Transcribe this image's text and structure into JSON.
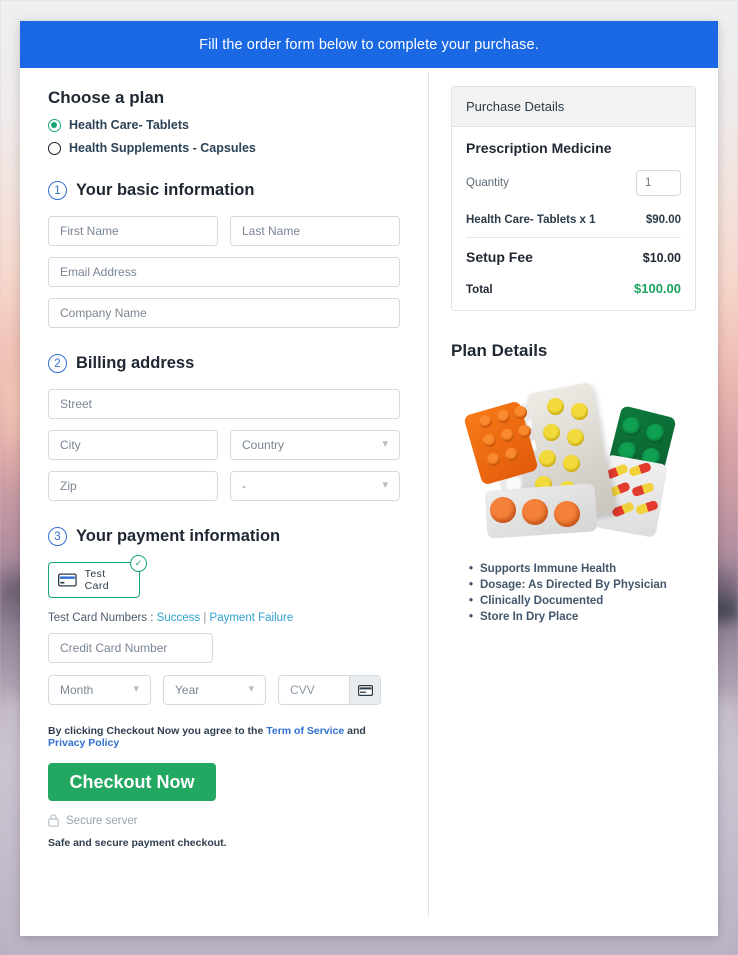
{
  "banner": {
    "text": "Fill the order form below to complete your purchase."
  },
  "plan": {
    "title": "Choose a plan",
    "options": [
      {
        "label": "Health Care- Tablets",
        "selected": true
      },
      {
        "label": "Health Supplements - Capsules",
        "selected": false
      }
    ]
  },
  "steps": [
    {
      "number": "1",
      "label": "Your basic information"
    },
    {
      "number": "2",
      "label": "Billing address"
    },
    {
      "number": "3",
      "label": "Your payment information"
    }
  ],
  "basic_info": {
    "first_name_placeholder": "First Name",
    "last_name_placeholder": "Last Name",
    "email_placeholder": "Email Address",
    "company_placeholder": "Company Name"
  },
  "billing": {
    "street_placeholder": "Street",
    "city_placeholder": "City",
    "country_value": "Country",
    "zip_placeholder": "Zip",
    "state_value": "-"
  },
  "payment": {
    "method_label": "Test Card",
    "method_selected": true,
    "check_glyph": "✓",
    "test_cards_prefix": "Test Card Numbers :",
    "test_card_success": "Success",
    "test_card_separator": "|",
    "test_card_failure": "Payment Failure",
    "card_number_placeholder": "Credit Card Number",
    "month_value": "Month",
    "year_value": "Year",
    "cvv_placeholder": "CVV"
  },
  "terms": {
    "prefix": "By clicking Checkout Now you agree to the ",
    "tos_link": "Term of Service",
    "middle": " and ",
    "privacy_link": "Privacy Policy"
  },
  "checkout": {
    "button_label": "Checkout Now",
    "secure_text": "Secure server",
    "safe_note": "Safe and secure payment checkout."
  },
  "purchase": {
    "header": "Purchase Details",
    "product_title": "Prescription Medicine",
    "quantity_label": "Quantity",
    "quantity_value": "1",
    "line_item_label": "Health Care- Tablets x 1",
    "line_item_price": "$90.00",
    "setup_fee_label": "Setup Fee",
    "setup_fee_price": "$10.00",
    "total_label": "Total",
    "total_price": "$100.00"
  },
  "plan_details": {
    "title": "Plan Details",
    "image_alt": "blister-packs-of-pills-and-capsules",
    "features": [
      "Supports Immune Health",
      "Dosage: As Directed By Physician",
      "Clinically Documented",
      "Store In Dry Place"
    ]
  },
  "colors": {
    "banner_blue": "#1b68e5",
    "accent_green": "#23a862",
    "total_green": "#19a35c",
    "link_blue": "#2f6fd0",
    "link_teal": "#2f9fd0",
    "step_blue": "#2f6fd0"
  }
}
